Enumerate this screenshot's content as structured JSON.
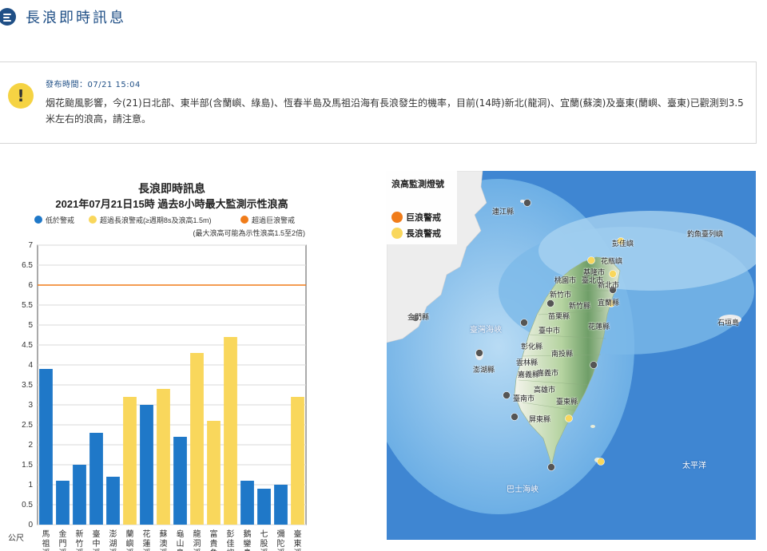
{
  "header": {
    "title": "長浪即時訊息"
  },
  "notice": {
    "time": "發布時間：07/21 15:04",
    "text": "烟花颱風影響，今(21)日北部、東半部(含蘭嶼、綠島)、恆春半島及馬祖沿海有長浪發生的機率，目前(14時)新北(龍洞)、宜蘭(蘇澳)及臺東(蘭嶼、臺東)已觀測到3.5米左右的浪高，請注意。"
  },
  "chart_data": {
    "type": "bar",
    "title": "長浪即時訊息",
    "subtitle": "2021年07月21日15時 過去8小時最大監測示性浪高",
    "note": "(最大浪高可能為示性浪高1.5至2倍)",
    "ylabel": "公尺",
    "ylim": [
      0,
      7
    ],
    "yticks": [
      "0",
      "0.5",
      "1",
      "1.5",
      "2",
      "2.5",
      "3",
      "3.5",
      "4",
      "4.5",
      "5",
      "5.5",
      "6",
      "6.5",
      "7"
    ],
    "threshold": 6,
    "legend": [
      {
        "label": "低於警戒",
        "color": "#1f78c8"
      },
      {
        "label": "超過長浪警戒(≥週期8s及浪高1.5m)",
        "color": "#f9d75c"
      },
      {
        "label": "超過巨浪警戒",
        "color": "#f07c1a"
      }
    ],
    "categories": [
      "馬祖浮",
      "金門浮",
      "新竹浮",
      "臺中浮",
      "澎湖浮",
      "蘭嶼浮",
      "花蓮浮",
      "蘇澳浮",
      "龜山島",
      "龍洞浮",
      "富貴角",
      "彭佳嶼",
      "鵝鑾鼻",
      "七股浮",
      "彌陀浮",
      "臺東浮"
    ],
    "values": [
      3.9,
      1.1,
      1.5,
      2.3,
      1.2,
      3.2,
      3.0,
      3.4,
      2.2,
      4.3,
      2.6,
      4.7,
      1.1,
      0.9,
      1.0,
      3.2
    ],
    "levels": [
      0,
      0,
      0,
      0,
      0,
      1,
      0,
      1,
      0,
      1,
      1,
      1,
      0,
      0,
      0,
      1
    ]
  },
  "map": {
    "legend_title": "浪高監測燈號",
    "legend_items": [
      {
        "label": "巨浪警戒",
        "color": "#f07c1a"
      },
      {
        "label": "長浪警戒",
        "color": "#f9d75c"
      }
    ],
    "places": [
      "連江縣",
      "金門縣",
      "澎湖縣",
      "臺灣海峽",
      "桃園市",
      "臺北市",
      "新北市",
      "基隆市",
      "新竹市",
      "新竹縣",
      "苗栗縣",
      "宜蘭縣",
      "臺中市",
      "花蓮縣",
      "彰化縣",
      "南投縣",
      "雲林縣",
      "嘉義市",
      "嘉義縣",
      "臺南市",
      "高雄市",
      "臺東縣",
      "屏東縣",
      "太平洋",
      "巴士海峽",
      "釣魚臺列嶼",
      "石垣島",
      "彭佳嶼",
      "花瓶嶼"
    ]
  }
}
